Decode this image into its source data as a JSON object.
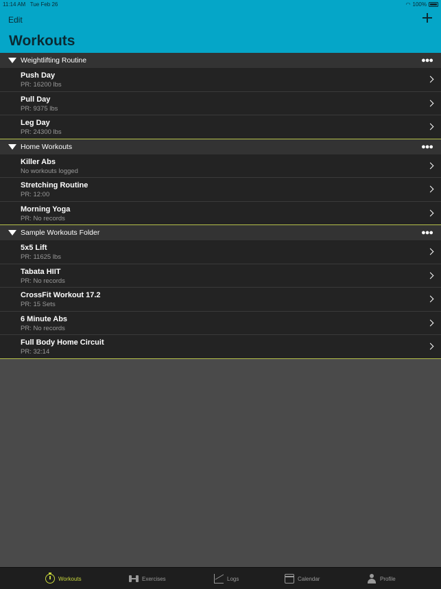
{
  "status_bar": {
    "time": "11:14 AM",
    "date": "Tue Feb 26",
    "battery": "100%"
  },
  "header": {
    "edit_label": "Edit",
    "title": "Workouts"
  },
  "folders": [
    {
      "name": "Weightlifting Routine",
      "workouts": [
        {
          "title": "Push Day",
          "subtitle": "PR: 16200 lbs"
        },
        {
          "title": "Pull Day",
          "subtitle": "PR: 9375 lbs"
        },
        {
          "title": "Leg Day",
          "subtitle": "PR: 24300 lbs"
        }
      ]
    },
    {
      "name": "Home Workouts",
      "workouts": [
        {
          "title": "Killer Abs",
          "subtitle": "No workouts logged"
        },
        {
          "title": "Stretching Routine",
          "subtitle": "PR: 12:00"
        },
        {
          "title": "Morning Yoga",
          "subtitle": "PR: No records"
        }
      ]
    },
    {
      "name": "Sample Workouts Folder",
      "workouts": [
        {
          "title": "5x5 Lift",
          "subtitle": "PR: 11625 lbs"
        },
        {
          "title": "Tabata HIIT",
          "subtitle": "PR: No records"
        },
        {
          "title": "CrossFit Workout 17.2",
          "subtitle": "PR: 15 Sets"
        },
        {
          "title": "6 Minute Abs",
          "subtitle": "PR: No records"
        },
        {
          "title": "Full Body Home Circuit",
          "subtitle": "PR: 32:14"
        }
      ]
    }
  ],
  "tabs": [
    {
      "label": "Workouts",
      "icon": "stopwatch-icon",
      "active": true
    },
    {
      "label": "Exercises",
      "icon": "dumbbell-icon",
      "active": false
    },
    {
      "label": "Logs",
      "icon": "chart-icon",
      "active": false
    },
    {
      "label": "Calendar",
      "icon": "calendar-icon",
      "active": false
    },
    {
      "label": "Profile",
      "icon": "profile-icon",
      "active": false
    }
  ],
  "colors": {
    "header": "#05a6c8",
    "accent": "#c9d83c",
    "row": "#232323",
    "folder": "#333333",
    "background": "#4a4a4a"
  }
}
